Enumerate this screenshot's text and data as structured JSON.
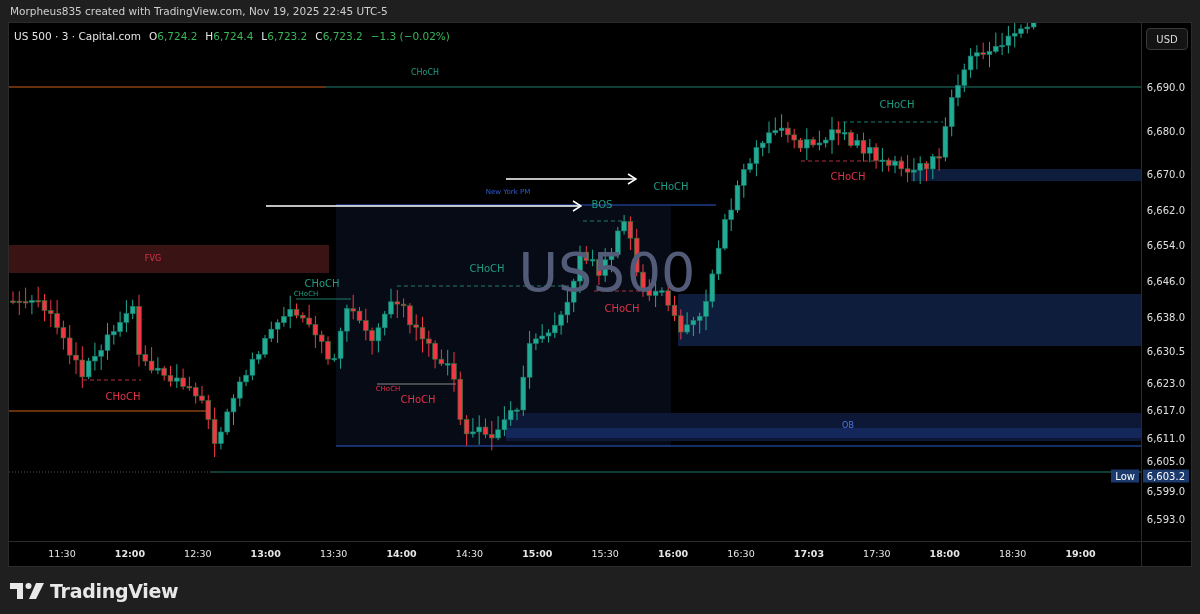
{
  "attribution": "Morpheus835 created with TradingView.com, Nov 19, 2025 22:45 UTC-5",
  "legend": {
    "symbol": "US 500 · 3 · Capital.com",
    "values": [
      {
        "label": "O",
        "value": "6,724.2"
      },
      {
        "label": "H",
        "value": "6,724.4"
      },
      {
        "label": "L",
        "value": "6,723.2"
      },
      {
        "label": "C",
        "value": "6,723.2"
      }
    ],
    "change": "−1.3 (−0.02%)"
  },
  "currency_button": "USD",
  "watermark": "US500",
  "session": {
    "label": "New York PM"
  },
  "fvg": {
    "label": "FVG"
  },
  "order_block": {
    "label": "OB"
  },
  "annotations": [
    {
      "text": "CHoCH",
      "kind": "bull"
    },
    {
      "text": "CHoCH",
      "kind": "bull"
    },
    {
      "text": "BOS",
      "kind": "bull"
    },
    {
      "text": "CHoCH",
      "kind": "bull"
    },
    {
      "text": "CHoCH",
      "kind": "bull"
    },
    {
      "text": "CHoCH",
      "kind": "bull"
    },
    {
      "text": "CHoCH",
      "kind": "bear"
    },
    {
      "text": "CHoCH",
      "kind": "bear"
    },
    {
      "text": "CHoCH",
      "kind": "bear"
    },
    {
      "text": "CHoCH",
      "kind": "bear"
    },
    {
      "text": "CHoCH",
      "kind": "bull"
    },
    {
      "text": "CHoCH",
      "kind": "bear"
    }
  ],
  "price_axis": {
    "ticks": [
      "6,690.0",
      "6,680.0",
      "6,670.0",
      "6,662.0",
      "6,654.0",
      "6,646.0",
      "6,638.0",
      "6,630.5",
      "6,623.0",
      "6,617.0",
      "6,611.0",
      "6,605.0",
      "6,599.0",
      "6,593.0"
    ],
    "low_label": "Low",
    "low_price": "6,603.2"
  },
  "time_axis": {
    "ticks": [
      {
        "label": "11:30",
        "major": false
      },
      {
        "label": "12:00",
        "major": true
      },
      {
        "label": "12:30",
        "major": false
      },
      {
        "label": "13:00",
        "major": true
      },
      {
        "label": "13:30",
        "major": false
      },
      {
        "label": "14:00",
        "major": true
      },
      {
        "label": "14:30",
        "major": false
      },
      {
        "label": "15:00",
        "major": true
      },
      {
        "label": "15:30",
        "major": false
      },
      {
        "label": "16:00",
        "major": true
      },
      {
        "label": "16:30",
        "major": false
      },
      {
        "label": "17:03",
        "major": true
      },
      {
        "label": "17:30",
        "major": false
      },
      {
        "label": "18:00",
        "major": true
      },
      {
        "label": "18:30",
        "major": false
      },
      {
        "label": "19:00",
        "major": true
      }
    ]
  },
  "footer": {
    "brand": "TradingView"
  }
}
